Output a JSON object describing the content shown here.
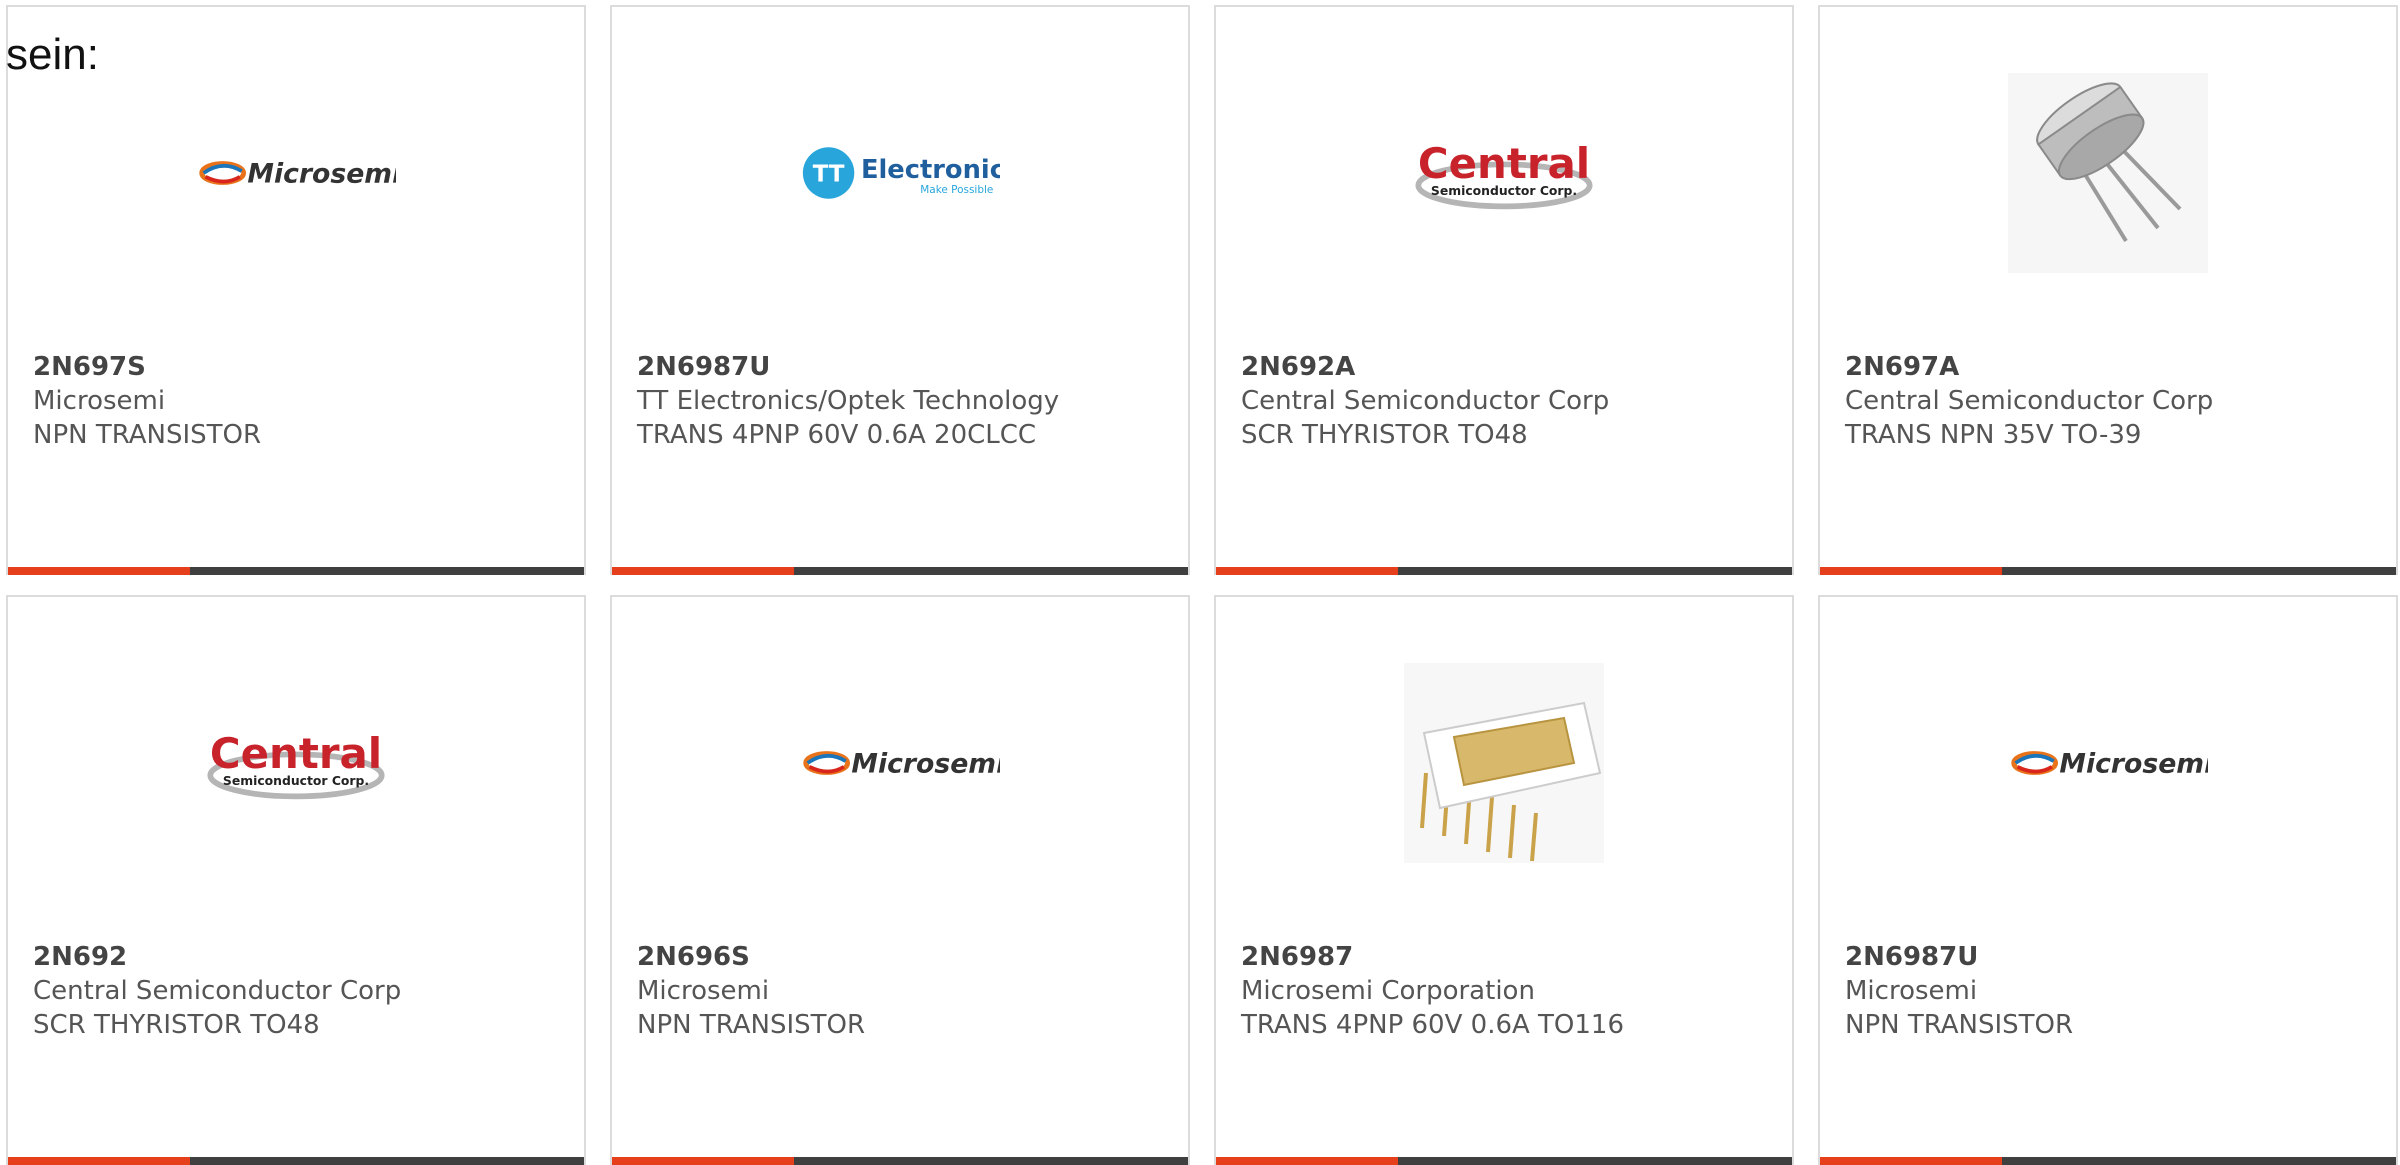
{
  "intro_text": "sein:",
  "colors": {
    "accent": "#e5401b",
    "bar": "#3f3f3f",
    "text": "#555555"
  },
  "products": [
    {
      "part": "2N697S",
      "manufacturer": "Microsemi",
      "description": "NPN TRANSISTOR",
      "image": "microsemi-logo",
      "logo_text": "Microsemi"
    },
    {
      "part": "2N6987U",
      "manufacturer": "TT Electronics/Optek Technology",
      "description": "TRANS 4PNP 60V 0.6A 20CLCC",
      "image": "tt-electronics-logo",
      "logo_text": "Electronics",
      "logo_tagline": "Make Possible",
      "logo_mark": "TT"
    },
    {
      "part": "2N692A",
      "manufacturer": "Central Semiconductor Corp",
      "description": "SCR THYRISTOR TO48",
      "image": "central-semiconductor-logo",
      "logo_text": "Central",
      "logo_sub": "Semiconductor Corp."
    },
    {
      "part": "2N697A",
      "manufacturer": "Central Semiconductor Corp",
      "description": "TRANS NPN 35V TO-39",
      "image": "to39-transistor-photo"
    },
    {
      "part": "2N692",
      "manufacturer": "Central Semiconductor Corp",
      "description": "SCR THYRISTOR TO48",
      "image": "central-semiconductor-logo",
      "logo_text": "Central",
      "logo_sub": "Semiconductor Corp."
    },
    {
      "part": "2N696S",
      "manufacturer": "Microsemi",
      "description": "NPN TRANSISTOR",
      "image": "microsemi-logo",
      "logo_text": "Microsemi"
    },
    {
      "part": "2N6987",
      "manufacturer": "Microsemi Corporation",
      "description": "TRANS 4PNP 60V 0.6A TO116",
      "image": "dip-ic-photo"
    },
    {
      "part": "2N6987U",
      "manufacturer": "Microsemi",
      "description": "NPN TRANSISTOR",
      "image": "microsemi-logo",
      "logo_text": "Microsemi"
    }
  ]
}
